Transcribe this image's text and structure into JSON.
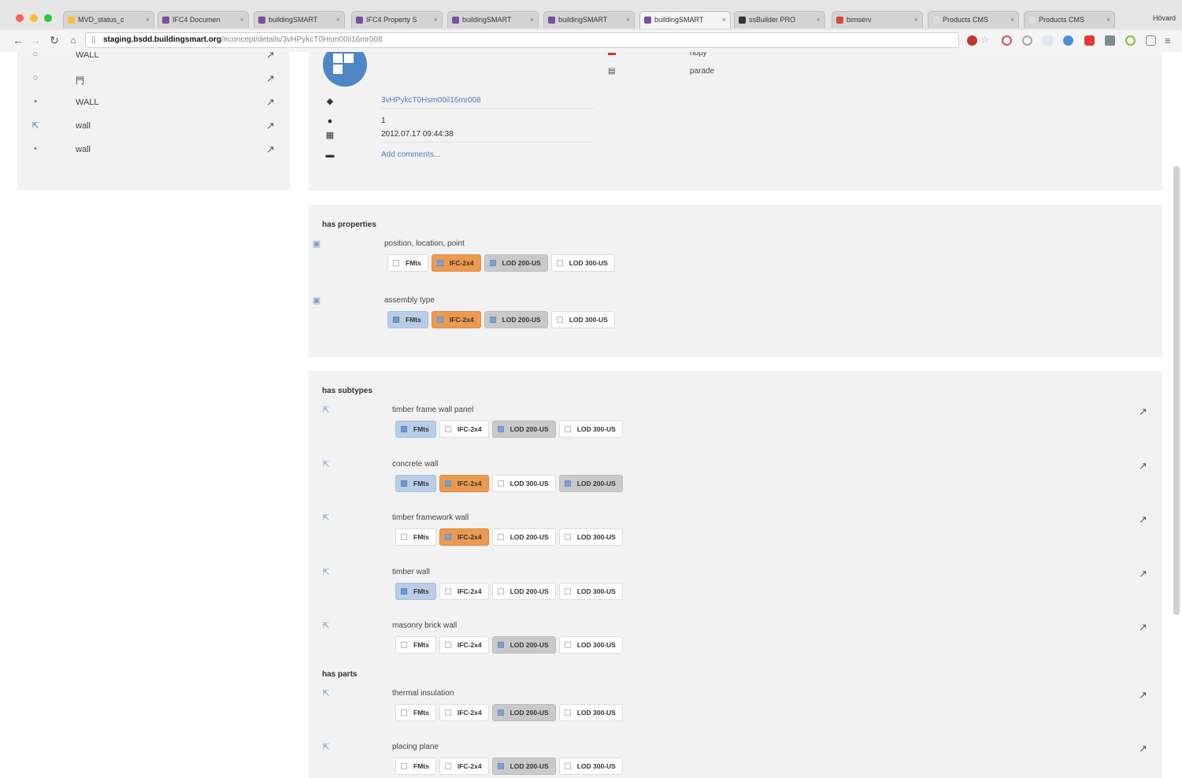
{
  "browser": {
    "tabs": [
      {
        "label": "MVD_status_c",
        "favicon": "#f3c13a"
      },
      {
        "label": "IFC4 Documen",
        "favicon": "#7a4fa1"
      },
      {
        "label": "buildingSMART",
        "favicon": "#7a4fa1"
      },
      {
        "label": "IFC4 Property S",
        "favicon": "#7a4fa1"
      },
      {
        "label": "buildingSMART",
        "favicon": "#7a4fa1"
      },
      {
        "label": "buildingSMART",
        "favicon": "#7a4fa1"
      },
      {
        "label": "buildingSMART",
        "favicon": "#7a4fa1",
        "active": true
      },
      {
        "label": "ssBuilder PRO",
        "favicon": "#333333"
      },
      {
        "label": "bimserv",
        "favicon": "#d94b3c"
      },
      {
        "label": "Products CMS",
        "favicon": "#dddddd"
      },
      {
        "label": "Products CMS",
        "favicon": "#dddddd"
      }
    ],
    "user": "Hövard",
    "url_host": "staging.bsdd.buildingsmart.org",
    "url_path": "/#concept/details/3vHPykcT0Hsm00il16mr008"
  },
  "left_list": [
    {
      "icon": "circle-icon",
      "glyph": "○",
      "label": "WALL"
    },
    {
      "icon": "circle-icon",
      "glyph": "○",
      "label": "門"
    },
    {
      "icon": "dot-icon",
      "glyph": "•",
      "label": "WALL"
    },
    {
      "icon": "subtype-icon",
      "glyph": "⇱",
      "label": "wall"
    },
    {
      "icon": "dot-icon",
      "glyph": "•",
      "label": "wall"
    }
  ],
  "info": {
    "guid": "3vHPykcT0Hsm00il16mr008",
    "version": "1",
    "date": "2012.07.17 09:44:38",
    "add_comments": "Add comments...",
    "meta": [
      {
        "icon": "flag-icon",
        "value": "nbpy"
      },
      {
        "icon": "id-card-icon",
        "value": "parade"
      }
    ]
  },
  "has_properties": {
    "title": "has properties",
    "rows": [
      {
        "label": "position, location, point",
        "chips": [
          {
            "label": "FMts",
            "state": "off"
          },
          {
            "label": "IFC-2x4",
            "state": "orange"
          },
          {
            "label": "LOD 200-US",
            "state": "grey"
          },
          {
            "label": "LOD 300-US",
            "state": "off"
          }
        ]
      },
      {
        "label": "assembly type",
        "chips": [
          {
            "label": "FMts",
            "state": "blue"
          },
          {
            "label": "IFC-2x4",
            "state": "orange"
          },
          {
            "label": "LOD 200-US",
            "state": "grey"
          },
          {
            "label": "LOD 300-US",
            "state": "off"
          }
        ]
      }
    ]
  },
  "has_subtypes": {
    "title": "has subtypes",
    "rows": [
      {
        "label": "timber frame wall panel",
        "chips": [
          {
            "label": "FMts",
            "state": "blue"
          },
          {
            "label": "IFC-2x4",
            "state": "off"
          },
          {
            "label": "LOD 200-US",
            "state": "grey"
          },
          {
            "label": "LOD 300-US",
            "state": "off"
          }
        ]
      },
      {
        "label": "concrete wall",
        "chips": [
          {
            "label": "FMts",
            "state": "blue"
          },
          {
            "label": "IFC-2x4",
            "state": "orange"
          },
          {
            "label": "LOD 300-US",
            "state": "off"
          },
          {
            "label": "LOD 200-US",
            "state": "grey"
          }
        ]
      },
      {
        "label": "timber framework wall",
        "chips": [
          {
            "label": "FMts",
            "state": "off"
          },
          {
            "label": "IFC-2x4",
            "state": "orange"
          },
          {
            "label": "LOD 200-US",
            "state": "off"
          },
          {
            "label": "LOD 300-US",
            "state": "off"
          }
        ]
      },
      {
        "label": "timber wall",
        "chips": [
          {
            "label": "FMts",
            "state": "blue"
          },
          {
            "label": "IFC-2x4",
            "state": "off"
          },
          {
            "label": "LOD 200-US",
            "state": "off"
          },
          {
            "label": "LOD 300-US",
            "state": "off"
          }
        ]
      },
      {
        "label": "masonry brick wall",
        "chips": [
          {
            "label": "FMts",
            "state": "off"
          },
          {
            "label": "IFC-2x4",
            "state": "off"
          },
          {
            "label": "LOD 200-US",
            "state": "grey"
          },
          {
            "label": "LOD 300-US",
            "state": "off"
          }
        ]
      }
    ]
  },
  "has_parts": {
    "title": "has parts",
    "rows": [
      {
        "label": "thermal insulation",
        "chips": [
          {
            "label": "FMts",
            "state": "off"
          },
          {
            "label": "IFC-2x4",
            "state": "off"
          },
          {
            "label": "LOD 200-US",
            "state": "grey"
          },
          {
            "label": "LOD 300-US",
            "state": "off"
          }
        ]
      },
      {
        "label": "placing plane",
        "chips": [
          {
            "label": "FMts",
            "state": "off"
          },
          {
            "label": "IFC-2x4",
            "state": "off"
          },
          {
            "label": "LOD 200-US",
            "state": "grey"
          },
          {
            "label": "LOD 300-US",
            "state": "off"
          }
        ]
      }
    ]
  }
}
